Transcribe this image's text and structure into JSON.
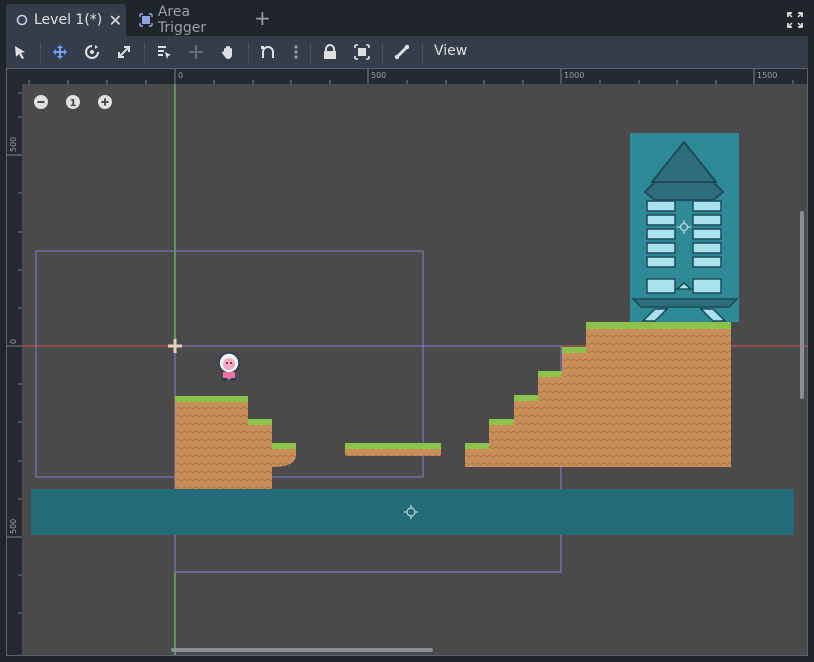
{
  "tabs": [
    {
      "label": "Level 1(*)",
      "icon": "circle-node-icon",
      "active": true
    },
    {
      "label": "Area Trigger",
      "icon": "area-node-icon",
      "active": false
    }
  ],
  "toolbar": {
    "tools": [
      "select-tool-icon",
      "move-tool-icon",
      "rotate-tool-icon",
      "scale-tool-icon",
      "list-select-icon",
      "pivot-icon",
      "pan-icon",
      "snap-icon",
      "more-icon",
      "lock-icon",
      "group-icon",
      "bone-icon"
    ],
    "view_label": "View"
  },
  "zoom": {
    "reset_label": "1"
  },
  "ruler": {
    "top_labels": [
      "0",
      "500",
      "1000",
      "1500"
    ],
    "left_labels": [
      "500",
      "0",
      "500"
    ]
  },
  "colors": {
    "editor_bg": "#4a4a4a",
    "water": "#246b78",
    "ground": "#c98f5a",
    "grass": "#8bc34a",
    "rocket": "#2d8a96",
    "selection": "#8a7ccf",
    "x_axis": "#d9534f",
    "y_axis": "#7fd17f"
  }
}
